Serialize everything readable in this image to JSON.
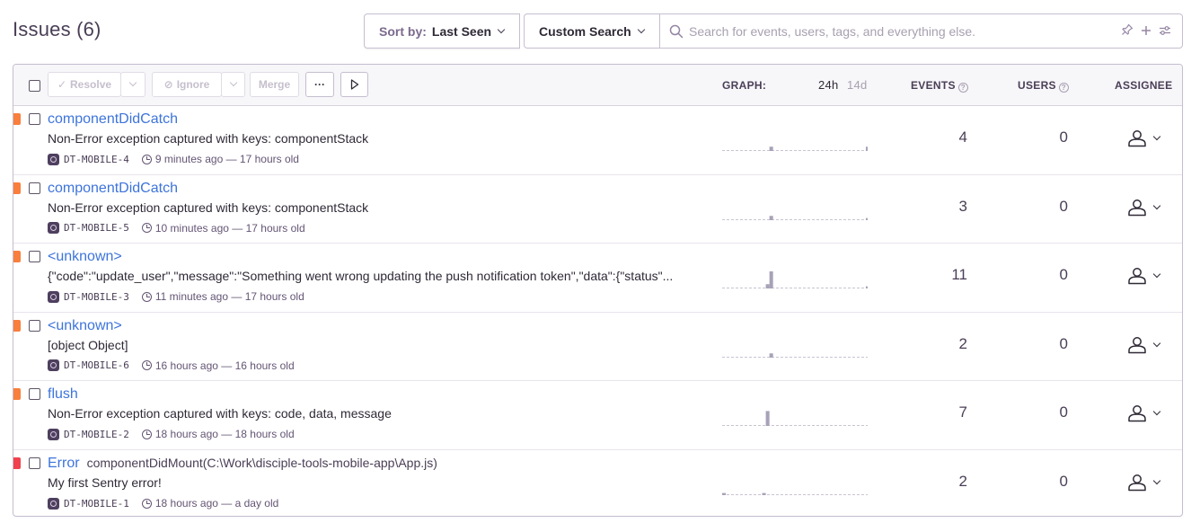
{
  "page": {
    "title": "Issues (6)"
  },
  "sort": {
    "label": "Sort by:",
    "value": "Last Seen"
  },
  "custom_search": {
    "label": "Custom Search"
  },
  "search": {
    "placeholder": "Search for events, users, tags, and everything else."
  },
  "toolbar": {
    "resolve": "Resolve",
    "ignore": "Ignore",
    "merge": "Merge",
    "more": "···"
  },
  "columns": {
    "graph": "GRAPH:",
    "period_24h": "24h",
    "period_14d": "14d",
    "events": "EVENTS",
    "users": "USERS",
    "assignee": "ASSIGNEE"
  },
  "colors": {
    "link": "#3d74db",
    "level_warning": "#f87f3d",
    "level_error": "#f0424e",
    "graph_bar": "#a8a2b8"
  },
  "issues": [
    {
      "title": "componentDidCatch",
      "location": "",
      "message": "Non-Error exception captured with keys: componentStack",
      "short_id": "DT-MOBILE-4",
      "time": "9 minutes ago — 17 hours old",
      "events": "4",
      "users": "0",
      "level": "warning",
      "graph": [
        0,
        0,
        0,
        0,
        0,
        0,
        0,
        0,
        0,
        0,
        0,
        0,
        0,
        0,
        0,
        0,
        0,
        0,
        0,
        0,
        0,
        0,
        0,
        0,
        0,
        0,
        2,
        0,
        0,
        0,
        0,
        0,
        0,
        0,
        0,
        0,
        0,
        0,
        0,
        0,
        0,
        0,
        0,
        0,
        0,
        0,
        0,
        0,
        0,
        0,
        0,
        0,
        0,
        0,
        0,
        0,
        0,
        0,
        0,
        0,
        0,
        0,
        0,
        0,
        0,
        0,
        0,
        0,
        0,
        0,
        0,
        0,
        0,
        0,
        0,
        0,
        0,
        0,
        0,
        2
      ]
    },
    {
      "title": "componentDidCatch",
      "location": "",
      "message": "Non-Error exception captured with keys: componentStack",
      "short_id": "DT-MOBILE-5",
      "time": "10 minutes ago — 17 hours old",
      "events": "3",
      "users": "0",
      "level": "warning",
      "graph": [
        0,
        0,
        0,
        0,
        0,
        0,
        0,
        0,
        0,
        0,
        0,
        0,
        0,
        0,
        0,
        0,
        0,
        0,
        0,
        0,
        0,
        0,
        0,
        0,
        0,
        0,
        2,
        0,
        0,
        0,
        0,
        0,
        0,
        0,
        0,
        0,
        0,
        0,
        0,
        0,
        0,
        0,
        0,
        0,
        0,
        0,
        0,
        0,
        0,
        0,
        0,
        0,
        0,
        0,
        0,
        0,
        0,
        0,
        0,
        0,
        0,
        0,
        0,
        0,
        0,
        0,
        0,
        0,
        0,
        0,
        0,
        0,
        0,
        0,
        0,
        0,
        0,
        0,
        0,
        1
      ]
    },
    {
      "title": "<unknown>",
      "location": "",
      "message": "{\"code\":\"update_user\",\"message\":\"Something went wrong updating the push notification token\",\"data\":{\"status\"...",
      "short_id": "DT-MOBILE-3",
      "time": "11 minutes ago — 17 hours old",
      "events": "11",
      "users": "0",
      "level": "warning",
      "graph": [
        0,
        0,
        0,
        0,
        0,
        0,
        0,
        0,
        0,
        0,
        0,
        0,
        0,
        0,
        0,
        0,
        0,
        0,
        0,
        0,
        0,
        0,
        0,
        0,
        2,
        0,
        8,
        0,
        0,
        0,
        0,
        0,
        0,
        0,
        0,
        0,
        0,
        0,
        0,
        0,
        0,
        0,
        0,
        0,
        0,
        0,
        0,
        0,
        0,
        0,
        0,
        0,
        0,
        0,
        0,
        0,
        0,
        0,
        0,
        0,
        0,
        0,
        0,
        0,
        0,
        0,
        0,
        0,
        0,
        0,
        0,
        0,
        0,
        0,
        0,
        0,
        0,
        0,
        0,
        1
      ]
    },
    {
      "title": "<unknown>",
      "location": "",
      "message": "[object Object]",
      "short_id": "DT-MOBILE-6",
      "time": "16 hours ago — 16 hours old",
      "events": "2",
      "users": "0",
      "level": "warning",
      "graph": [
        0,
        0,
        0,
        0,
        0,
        0,
        0,
        0,
        0,
        0,
        0,
        0,
        0,
        0,
        0,
        0,
        0,
        0,
        0,
        0,
        0,
        0,
        0,
        0,
        0,
        0,
        2,
        0,
        0,
        0,
        0,
        0,
        0,
        0,
        0,
        0,
        0,
        0,
        0,
        0,
        0,
        0,
        0,
        0,
        0,
        0,
        0,
        0,
        0,
        0,
        0,
        0,
        0,
        0,
        0,
        0,
        0,
        0,
        0,
        0,
        0,
        0,
        0,
        0,
        0,
        0,
        0,
        0,
        0,
        0,
        0,
        0,
        0,
        0,
        0,
        0,
        0,
        0,
        0,
        0
      ]
    },
    {
      "title": "flush",
      "location": "",
      "message": "Non-Error exception captured with keys: code, data, message",
      "short_id": "DT-MOBILE-2",
      "time": "18 hours ago — 18 hours old",
      "events": "7",
      "users": "0",
      "level": "warning",
      "graph": [
        0,
        0,
        0,
        0,
        0,
        0,
        0,
        0,
        0,
        0,
        0,
        0,
        0,
        0,
        0,
        0,
        0,
        0,
        0,
        0,
        0,
        0,
        0,
        0,
        7,
        0,
        0,
        0,
        0,
        0,
        0,
        0,
        0,
        0,
        0,
        0,
        0,
        0,
        0,
        0,
        0,
        0,
        0,
        0,
        0,
        0,
        0,
        0,
        0,
        0,
        0,
        0,
        0,
        0,
        0,
        0,
        0,
        0,
        0,
        0,
        0,
        0,
        0,
        0,
        0,
        0,
        0,
        0,
        0,
        0,
        0,
        0,
        0,
        0,
        0,
        0,
        0,
        0,
        0,
        0
      ]
    },
    {
      "title": "Error",
      "location": "componentDidMount(C:\\Work\\disciple-tools-mobile-app\\App.js)",
      "message": "My first Sentry error!",
      "short_id": "DT-MOBILE-1",
      "time": "18 hours ago — a day old",
      "events": "2",
      "users": "0",
      "level": "error",
      "graph": [
        1,
        0,
        0,
        0,
        0,
        0,
        0,
        0,
        0,
        0,
        0,
        0,
        0,
        0,
        0,
        0,
        0,
        0,
        0,
        0,
        0,
        0,
        1,
        0,
        0,
        0,
        0,
        0,
        0,
        0,
        0,
        0,
        0,
        0,
        0,
        0,
        0,
        0,
        0,
        0,
        0,
        0,
        0,
        0,
        0,
        0,
        0,
        0,
        0,
        0,
        0,
        0,
        0,
        0,
        0,
        0,
        0,
        0,
        0,
        0,
        0,
        0,
        0,
        0,
        0,
        0,
        0,
        0,
        0,
        0,
        0,
        0,
        0,
        0,
        0,
        0,
        0,
        0,
        0,
        0
      ]
    }
  ]
}
